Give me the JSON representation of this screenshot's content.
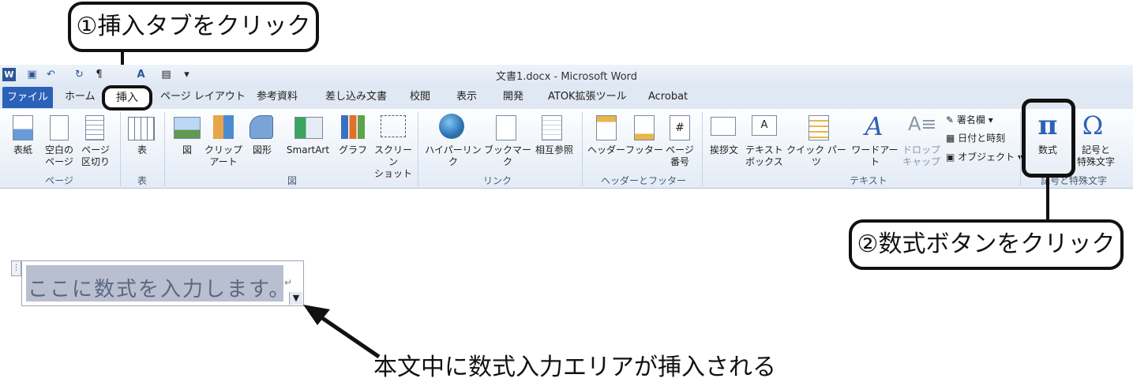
{
  "callouts": {
    "step1": "①挿入タブをクリック",
    "step2": "②数式ボタンをクリック",
    "note": "本文中に数式入力エリアが挿入される"
  },
  "window": {
    "title": "文書1.docx - Microsoft Word"
  },
  "tabs": {
    "file": "ファイル",
    "items": [
      "ホーム",
      "挿入",
      "ページ レイアウト",
      "参考資料",
      "差し込み文書",
      "校閲",
      "表示",
      "開発",
      "ATOK拡張ツール",
      "Acrobat"
    ]
  },
  "ribbon": {
    "groups": [
      "ページ",
      "表",
      "図",
      "リンク",
      "ヘッダーとフッター",
      "テキスト",
      "記号と特殊文字"
    ],
    "buttons": {
      "cover": "表紙",
      "blank_page": "空白の\nページ",
      "page_break": "ページ\n区切り",
      "table": "表",
      "picture": "図",
      "clipart": "クリップ\nアート",
      "shapes": "図形",
      "smartart": "SmartArt",
      "chart": "グラフ",
      "screenshot": "スクリーン\nショット",
      "hyperlink": "ハイパーリンク",
      "bookmark": "ブックマーク",
      "crossref": "相互参照",
      "header": "ヘッダー",
      "footer": "フッター",
      "page_number": "ページ\n番号",
      "greeting": "挨拶文",
      "textbox": "テキスト\nボックス",
      "quickparts": "クイック パーツ",
      "wordart": "ワードアート",
      "dropcap": "ドロップ\nキャップ",
      "signature": "署名欄",
      "datetime": "日付と時刻",
      "object": "オブジェクト",
      "equation": "数式",
      "symbol": "記号と\n特殊文字"
    }
  },
  "equation_area": {
    "placeholder": "ここに数式を入力します。"
  },
  "colors": {
    "file_tab": "#2b62b8",
    "ribbon": "#e3ebf6",
    "equation_field": "#b9bfd0"
  }
}
